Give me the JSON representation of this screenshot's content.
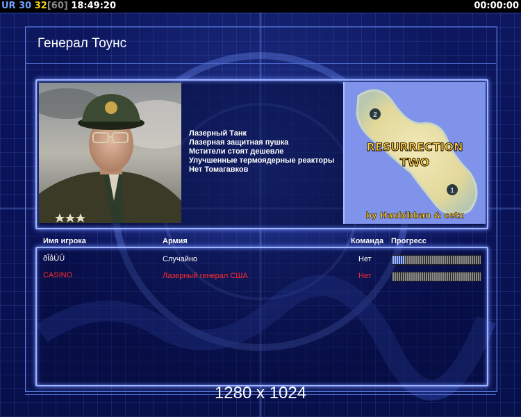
{
  "hud": {
    "label": "UR",
    "fps": "30",
    "fps2": "32",
    "fps_max": "[60]",
    "clock": "18:49:20",
    "timer": "00:00:00"
  },
  "general": {
    "name": "Генерал Тоунс",
    "bonuses": [
      "Лазерный Танк",
      "Лазерная защитная пушка",
      "Мстители стоят дешевле",
      "Улучшенные термоядерные реакторы",
      "Нет Томагавков"
    ]
  },
  "map": {
    "title_line1": "RESURRECTION",
    "title_line2": "TWO",
    "credit": "by Haubibban & cetx",
    "start_markers": [
      "2",
      "1"
    ]
  },
  "table": {
    "headers": {
      "player": "Имя игрока",
      "army": "Армия",
      "team": "Команда",
      "progress": "Прогресс"
    },
    "players": [
      {
        "name": "ðÎåÙÛ",
        "army": "Случайно",
        "team": "Нет",
        "progress": 0.13,
        "color": "#ffffff"
      },
      {
        "name": "CASINO",
        "army": "Лазерный генерал США",
        "team": "Нет",
        "progress": 0.0,
        "color": "#ff2a2a"
      }
    ]
  },
  "resolution": "1280 x 1024",
  "colors": {
    "background": "#0a1150",
    "panel_border": "#9fb4ff",
    "accent_red": "#ff2a2a"
  }
}
